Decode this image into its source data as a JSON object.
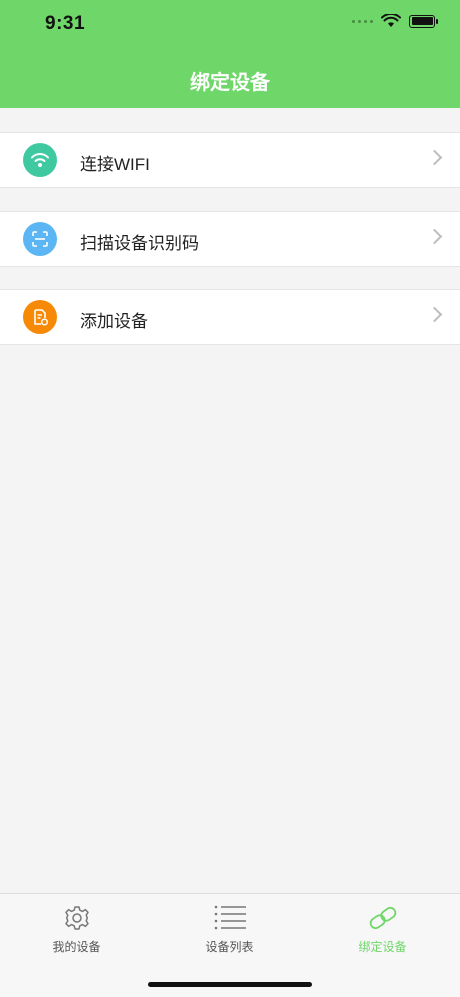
{
  "status_bar": {
    "time": "9:31"
  },
  "header": {
    "title": "绑定设备"
  },
  "menu": {
    "items": [
      {
        "label": "连接WIFI",
        "icon": "wifi-icon",
        "color": "#3ec9a0"
      },
      {
        "label": "扫描设备识别码",
        "icon": "scan-icon",
        "color": "#5bb6f3"
      },
      {
        "label": "添加设备",
        "icon": "add-device-icon",
        "color": "#f68a07"
      }
    ]
  },
  "tabbar": {
    "tabs": [
      {
        "label": "我的设备",
        "icon": "gear-icon"
      },
      {
        "label": "设备列表",
        "icon": "list-icon"
      },
      {
        "label": "绑定设备",
        "icon": "link-icon",
        "active": true
      }
    ]
  },
  "colors": {
    "primary": "#6fd669",
    "background": "#f4f4f4"
  }
}
